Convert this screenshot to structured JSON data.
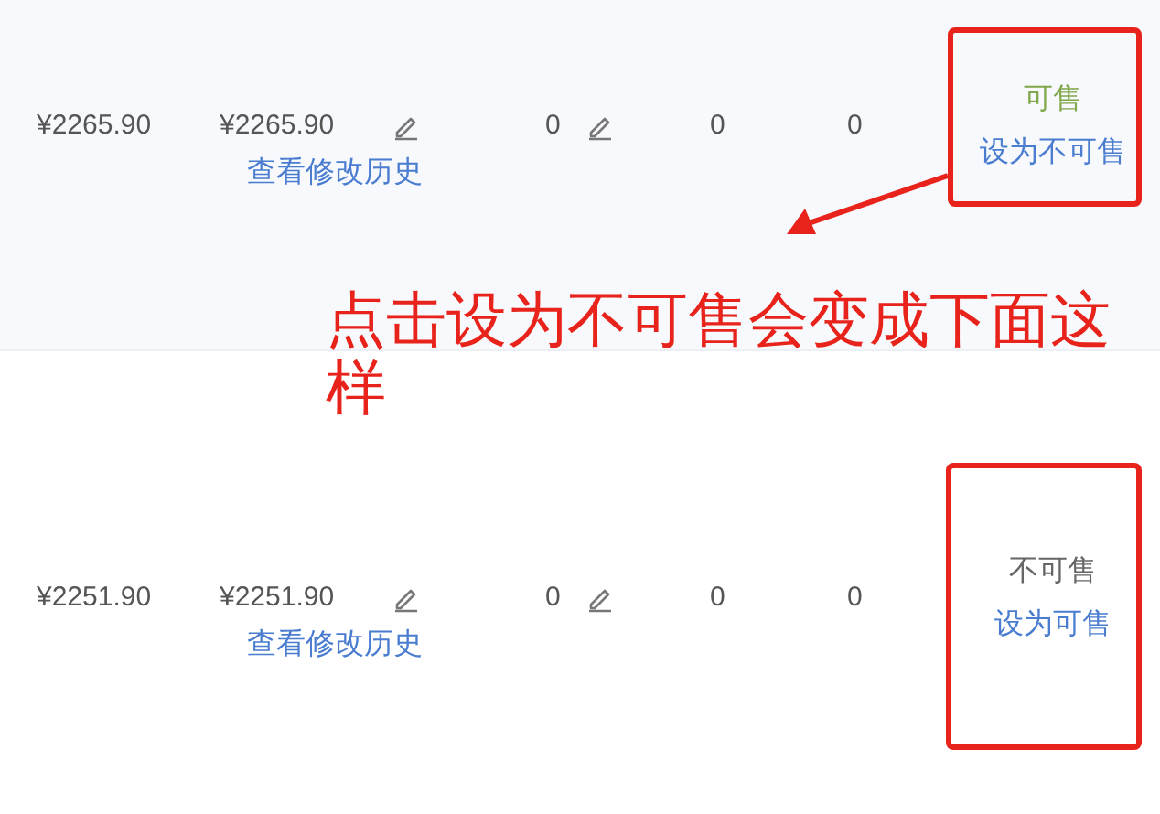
{
  "rows": [
    {
      "price": "¥2265.90",
      "edited_price": "¥2265.90",
      "history_link": "查看修改历史",
      "stock": "0",
      "column_5": "0",
      "column_6": "0",
      "sellable": true,
      "status": "可售",
      "action": "设为不可售"
    },
    {
      "price": "¥2251.90",
      "edited_price": "¥2251.90",
      "history_link": "查看修改历史",
      "stock": "0",
      "column_5": "0",
      "column_6": "0",
      "sellable": false,
      "status": "不可售",
      "action": "设为可售"
    }
  ],
  "annotation": {
    "note": "点击设为不可售会变成下面这样"
  }
}
